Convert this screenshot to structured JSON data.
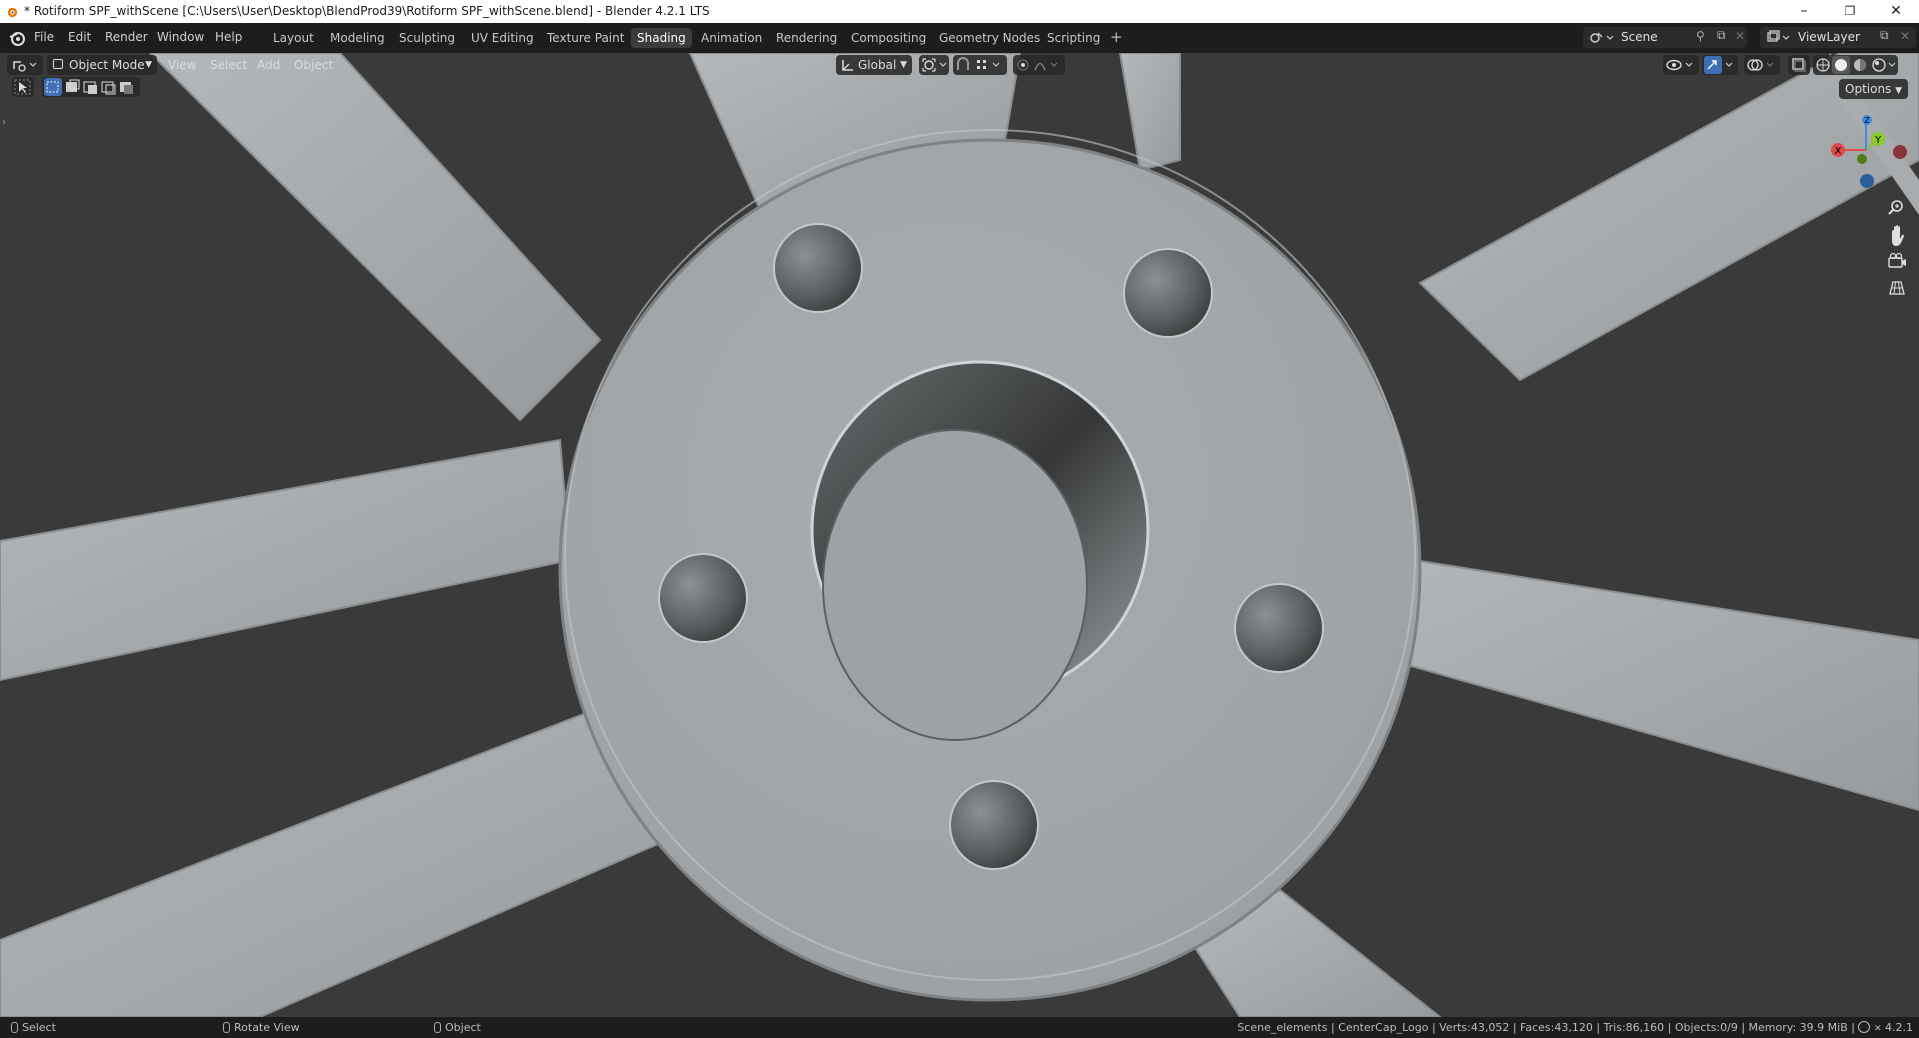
{
  "window": {
    "title": "* Rotiform SPF_withScene [C:\\Users\\User\\Desktop\\BlendProd39\\Rotiform SPF_withScene.blend] - Blender 4.2.1 LTS",
    "minimize": "–",
    "restore": "❐",
    "close": "✕"
  },
  "menus": [
    "File",
    "Edit",
    "Render",
    "Window",
    "Help"
  ],
  "workspaces": [
    "Layout",
    "Modeling",
    "Sculpting",
    "UV Editing",
    "Texture Paint",
    "Shading",
    "Animation",
    "Rendering",
    "Compositing",
    "Geometry Nodes",
    "Scripting"
  ],
  "active_workspace": "Shading",
  "add_workspace": "+",
  "scene": {
    "name": "Scene",
    "view_layer": "ViewLayer"
  },
  "viewport_header": {
    "mode": "Object Mode",
    "menus": [
      "View",
      "Select",
      "Add",
      "Object"
    ],
    "transform_orientation": "Global",
    "options": "Options"
  },
  "gizmo": {
    "x": "X",
    "y": "Y",
    "z": "Z"
  },
  "statusbar": {
    "select": "Select",
    "rotate": "Rotate View",
    "object": "Object",
    "stats": "Scene_elements | CenterCap_Logo | Verts:43,052 | Faces:43,120 | Tris:86,160 | Objects:0/9 | Memory: 39.9 MiB | ",
    "version": "4.2.1"
  },
  "colors": {
    "viewport_bg": "#3a3a3a",
    "mesh": "#a2a6a8",
    "header_bg": "#1d1d1d",
    "active_tab": "#3c3c3c",
    "axis_x": "#e04a4a",
    "axis_y": "#8ac926",
    "axis_z": "#3f8ee0"
  }
}
